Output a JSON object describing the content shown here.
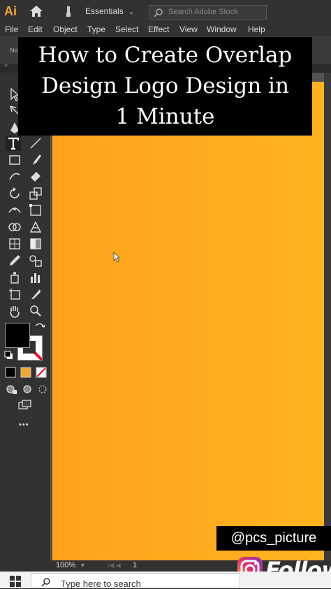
{
  "app": {
    "logo": "Ai",
    "workspace": "Essentials",
    "search_placeholder": "Search Adobe Stock"
  },
  "menu": [
    "File",
    "Edit",
    "Object",
    "Type",
    "Select",
    "Effect",
    "View",
    "Window",
    "Help"
  ],
  "control_bar": {
    "label": "No"
  },
  "tools_panel": {
    "collapse": "«",
    "more": "•••"
  },
  "overlay": {
    "title_lines": [
      "How to Create Overlap",
      "Design Logo Design in",
      "1 Minute"
    ],
    "handle": "@pcs_picture",
    "follow": "Follow"
  },
  "status": {
    "zoom": "100%",
    "page": "1"
  },
  "taskbar": {
    "search_placeholder": "Type here to search"
  },
  "colors": {
    "artboard": "#ffa41c",
    "accent": "#f7a53a",
    "fill": "#000000"
  }
}
